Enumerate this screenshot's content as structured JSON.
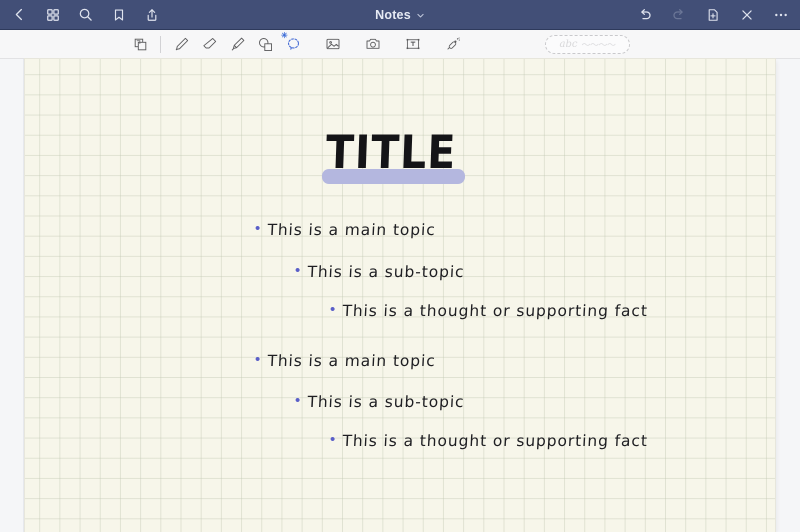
{
  "navbar": {
    "title": "Notes",
    "chevron": "chevron-down",
    "left_icons": [
      {
        "name": "back-icon",
        "label": "Back"
      },
      {
        "name": "grid-view-icon",
        "label": "Page Grid"
      },
      {
        "name": "search-icon",
        "label": "Search"
      },
      {
        "name": "bookmark-icon",
        "label": "Bookmark"
      },
      {
        "name": "share-icon",
        "label": "Share"
      }
    ],
    "right_icons": [
      {
        "name": "undo-icon",
        "label": "Undo",
        "state": "enabled"
      },
      {
        "name": "redo-icon",
        "label": "Redo",
        "state": "disabled"
      },
      {
        "name": "add-page-icon",
        "label": "Add Page",
        "state": "enabled"
      },
      {
        "name": "close-icon",
        "label": "Close",
        "state": "enabled"
      },
      {
        "name": "more-icon",
        "label": "More",
        "state": "enabled"
      }
    ]
  },
  "toolbar": {
    "layers_label": "Layers",
    "tools": [
      {
        "name": "pen-tool",
        "label": "Pen",
        "selected": false
      },
      {
        "name": "eraser-tool",
        "label": "Eraser",
        "selected": false
      },
      {
        "name": "highlighter-tool",
        "label": "Highlighter",
        "selected": false
      },
      {
        "name": "shape-tool",
        "label": "Shapes",
        "selected": false
      },
      {
        "name": "lasso-select-tool",
        "label": "Lasso Select",
        "selected": true
      },
      {
        "name": "image-tool",
        "label": "Insert Image",
        "selected": false
      },
      {
        "name": "camera-tool",
        "label": "Camera",
        "selected": false
      },
      {
        "name": "text-box-tool",
        "label": "Text Box",
        "selected": false
      },
      {
        "name": "sticker-tool",
        "label": "Stickers",
        "selected": false
      }
    ],
    "search_pill": {
      "abc": "abc",
      "wave": "〜〜〜〜"
    }
  },
  "page": {
    "title": "TITLE",
    "highlight_color": "#b4b7df",
    "bullet_color": "#5a5fc8",
    "paper_color": "#f7f6ea",
    "grid_line_color": "#c1c7b2",
    "bullet_glyph": "•",
    "notes": [
      {
        "level": 1,
        "text": "This is a main topic"
      },
      {
        "level": 2,
        "text": "This is a sub-topic"
      },
      {
        "level": 3,
        "text": "This is a thought or supporting fact"
      },
      {
        "level": 1,
        "text": "This is a main topic"
      },
      {
        "level": 2,
        "text": "This is a sub-topic"
      },
      {
        "level": 3,
        "text": "This is a thought or supporting fact"
      }
    ]
  },
  "theme": {
    "navbar_bg": "#424f77",
    "toolbar_bg": "#f7f7f8",
    "canvas_bg": "#f5f6f8",
    "accent": "#4a6fd6"
  }
}
